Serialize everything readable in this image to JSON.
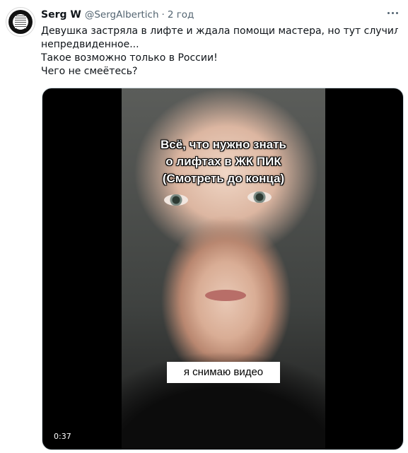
{
  "tweet": {
    "author_name": "Serg W",
    "author_handle": "@SergAlbertich",
    "separator": "·",
    "time": "2 год",
    "text_lines": [
      "Девушка застряла в лифте и ждала помощи мастера, но тут случилось",
      "непредвиденное...",
      "Такое возможно только в России!",
      "Чего не смеётесь?"
    ]
  },
  "media": {
    "caption_top_lines": [
      "Всё, что нужно знать",
      "о лифтах в ЖК ПИК",
      "(Смотреть до конца)"
    ],
    "caption_bottom": "я снимаю видео",
    "duration": "0:37"
  },
  "icons": {
    "more": "more-dots-icon",
    "avatar": "avatar-image"
  },
  "colors": {
    "text": "#0f1419",
    "secondary_text": "#536471",
    "media_border": "#cfd9de"
  }
}
